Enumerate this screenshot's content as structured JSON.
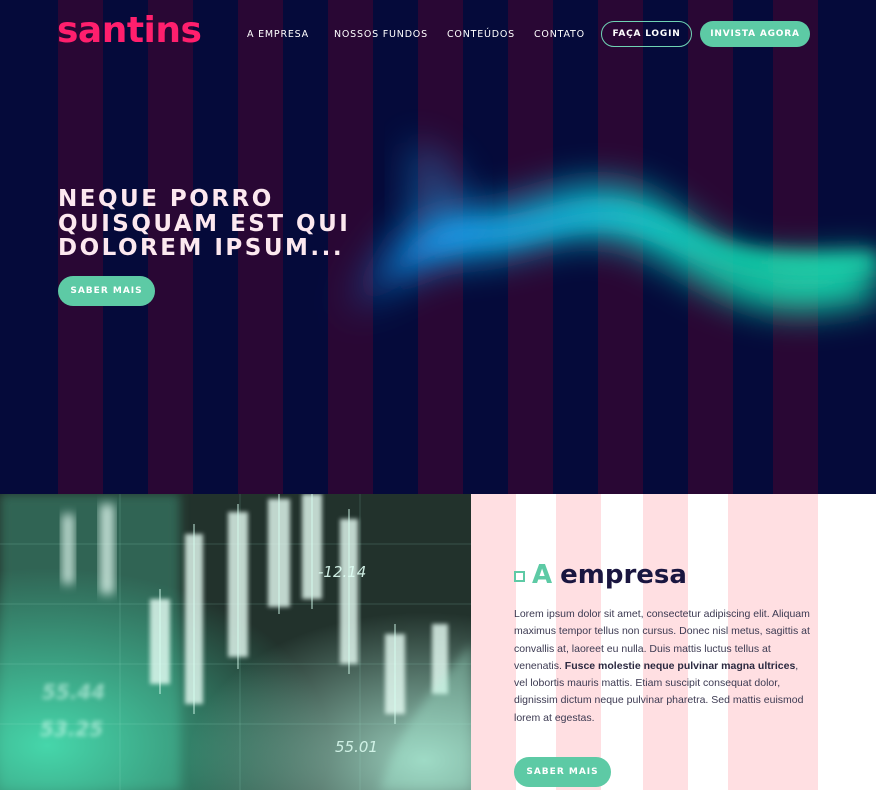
{
  "brand": {
    "logo": "santins",
    "color": "#ff1f6d"
  },
  "nav": {
    "items": [
      "A EMPRESA",
      "NOSSOS FUNDOS",
      "CONTEÚDOS",
      "CONTATO"
    ],
    "login": "FAÇA LOGIN",
    "invest": "INVISTA AGORA"
  },
  "hero": {
    "title": "NEQUE PORRO QUISQUAM EST QUI DOLOREM IPSUM...",
    "cta": "SABER MAIS"
  },
  "about": {
    "heading_accent": "A",
    "heading_rest": "empresa",
    "text_part1": "Lorem ipsum dolor sit amet, consectetur adipiscing elit. Aliquam maximus tempor tellus non cursus. Donec nisl metus, sagittis at convallis at, laoreet eu nulla. Duis mattis luctus tellus at venenatis. ",
    "text_bold": "Fusce molestie neque pulvinar magna ultrices",
    "text_part2": ", vel lobortis mauris mattis. Etiam suscipit consequat dolor, dignissim dictum neque pulvinar pharetra. Sed mattis euismod lorem at egestas.",
    "cta": "SABER MAIS"
  },
  "finance_image": {
    "numbers": [
      "-12.14",
      "55.44",
      "53.25",
      "55.01"
    ]
  },
  "colors": {
    "accent": "#5dcaa5",
    "hero_bg": "#050a3a",
    "stripe": "#2c0834",
    "about_stripe": "#ffdfe2"
  }
}
